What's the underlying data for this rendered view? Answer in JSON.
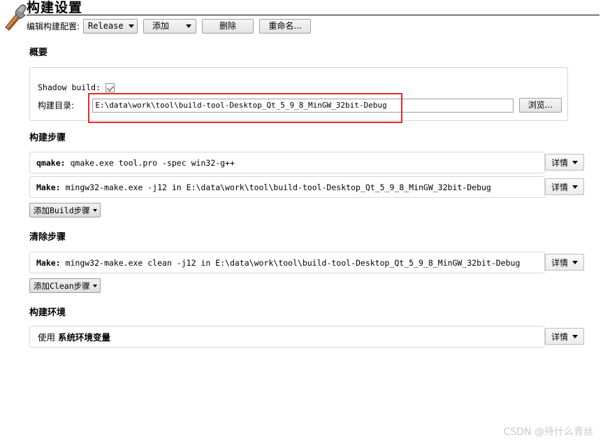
{
  "header": {
    "icon": "hammer-icon",
    "title": "构建设置"
  },
  "config_bar": {
    "label": "编辑构建配置:",
    "selected_configuration": "Release",
    "add_label": "添加",
    "delete_label": "删除",
    "rename_label": "重命名..."
  },
  "summary": {
    "heading": "概要",
    "shadow_build_label": "Shadow build:",
    "shadow_build_checked": true,
    "build_directory_label": "构建目录:",
    "build_directory_value": "E:\\data\\work\\tool\\build-tool-Desktop_Qt_5_9_8_MinGW_32bit-Debug",
    "browse_label": "浏览..."
  },
  "build_steps": {
    "heading": "构建步骤",
    "steps": [
      {
        "kind": "qmake",
        "prefix": "qmake:",
        "command": "qmake.exe tool.pro -spec win32-g++",
        "details_label": "详情"
      },
      {
        "kind": "make",
        "prefix": "Make:",
        "command": "mingw32-make.exe -j12 in E:\\data\\work\\tool\\build-tool-Desktop_Qt_5_9_8_MinGW_32bit-Debug",
        "details_label": "详情"
      }
    ],
    "add_button_label": "添加Build步骤"
  },
  "clean_steps": {
    "heading": "清除步骤",
    "steps": [
      {
        "kind": "make",
        "prefix": "Make:",
        "command": "mingw32-make.exe clean -j12 in E:\\data\\work\\tool\\build-tool-Desktop_Qt_5_9_8_MinGW_32bit-Debug",
        "details_label": "详情"
      }
    ],
    "add_button_label": "添加Clean步骤"
  },
  "build_environment": {
    "heading": "构建环境",
    "use_label": "使用",
    "environment_name": "系统环境变量",
    "details_label": "详情"
  },
  "annotation": {
    "color": "#e8292b",
    "target": "build-directory-input"
  },
  "watermark": {
    "text": "CSDN @待什么青丝",
    "color": "#c9c9c9"
  }
}
